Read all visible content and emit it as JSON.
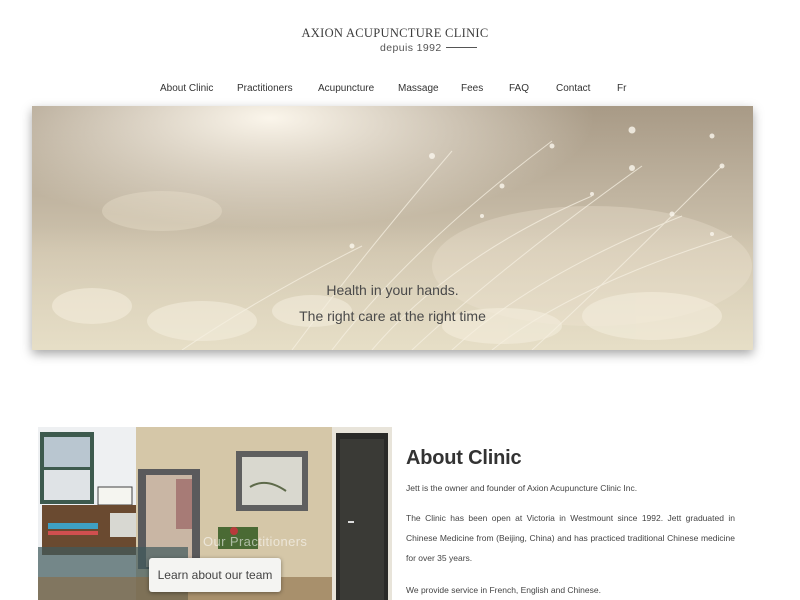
{
  "logo": {
    "title": "AXION ACUPUNCTURE CLINIC",
    "subtitle": "depuis 1992"
  },
  "nav": {
    "items": [
      {
        "label": "About Clinic"
      },
      {
        "label": "Practitioners"
      },
      {
        "label": "Acupuncture"
      },
      {
        "label": "Massage"
      },
      {
        "label": "Fees"
      },
      {
        "label": "FAQ"
      },
      {
        "label": "Contact"
      },
      {
        "label": "Fr"
      }
    ]
  },
  "hero": {
    "line1": "Health in your hands.",
    "line2": "The right care at the right time"
  },
  "photo": {
    "caption": "Our Practitioners",
    "button_label": "Learn about our team"
  },
  "about": {
    "title": "About Clinic",
    "p1": "Jett is the owner and founder of Axion Acupuncture Clinic Inc.",
    "p2": "The Clinic has been open at Victoria in Westmount since 1992. Jett graduated in Chinese Medicine from (Beijing, China) and has practiced traditional Chinese medicine for over 35 years.",
    "p3": "We provide service in French, English and Chinese."
  },
  "colors": {
    "text": "#3a3a3a",
    "hero_tint": "#bfb39f",
    "background": "#ffffff"
  }
}
